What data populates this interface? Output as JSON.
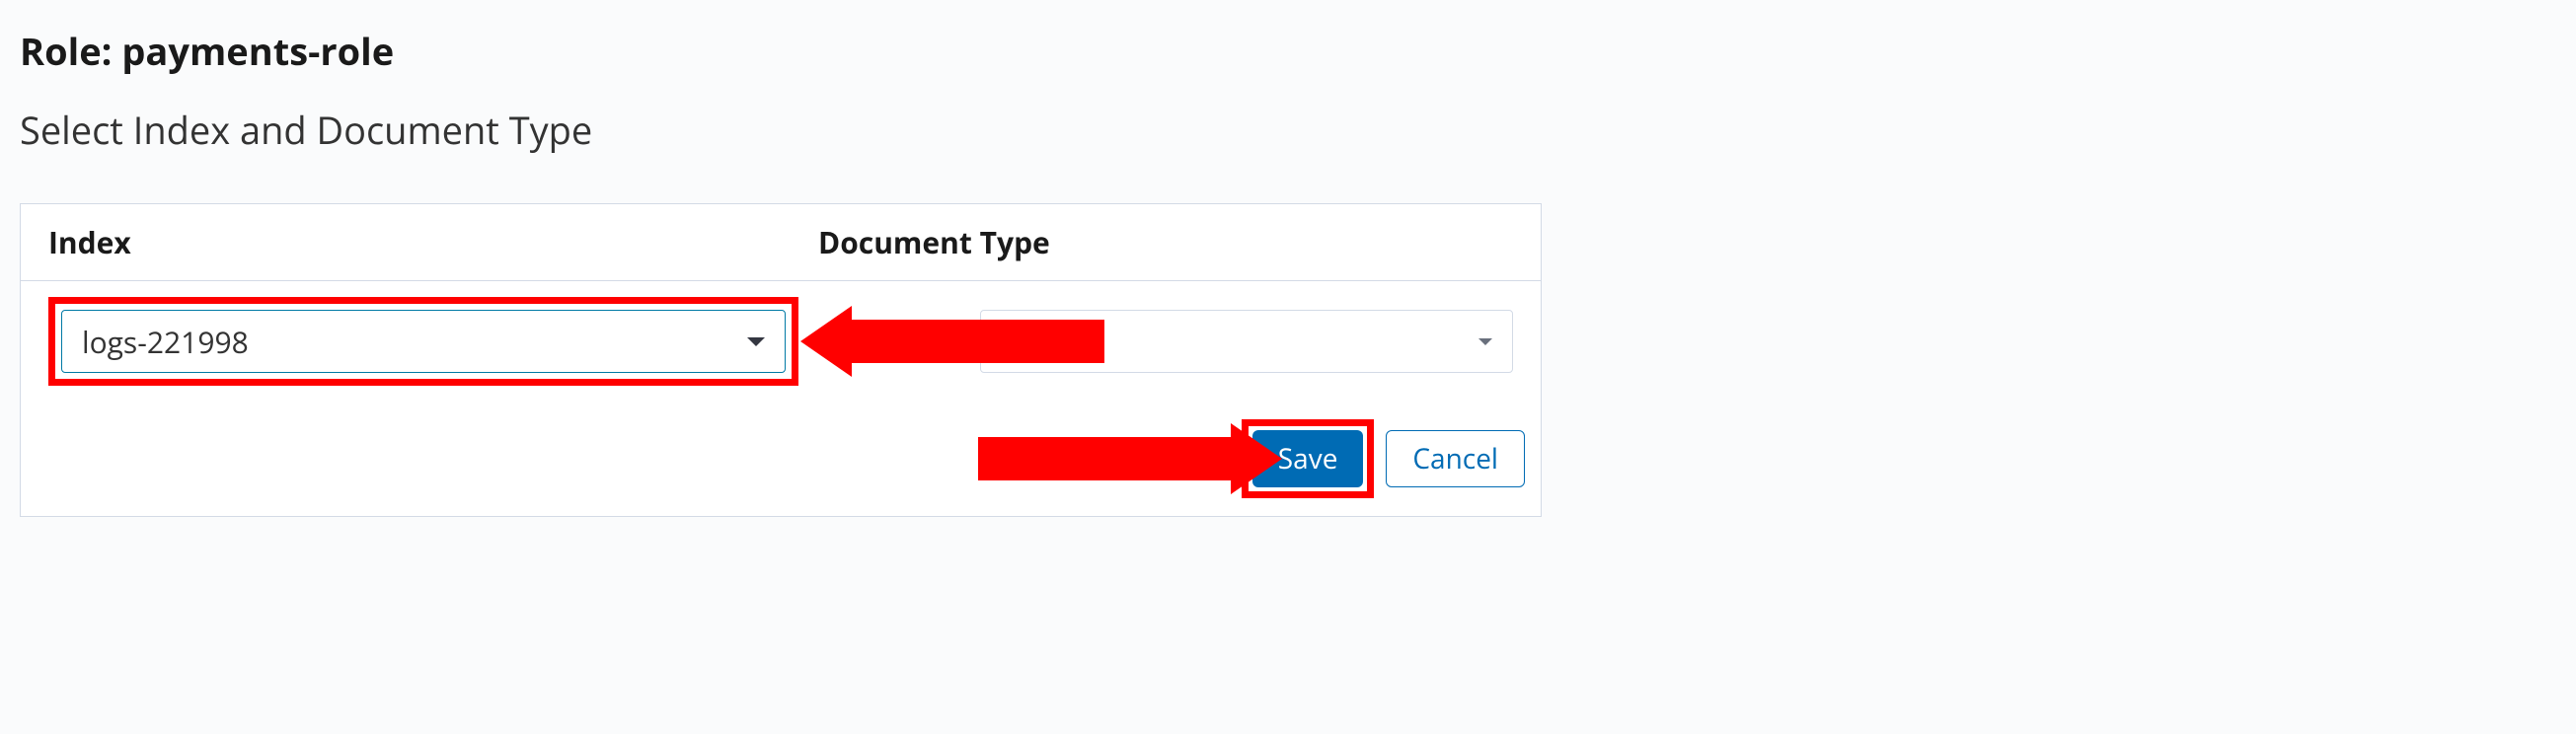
{
  "role_label": "Role: ",
  "role_name": "payments-role",
  "subheading": "Select Index and Document Type",
  "columns": {
    "index": "Index",
    "doctype": "Document Type"
  },
  "index_value": "logs-221998",
  "doctype_value": "",
  "buttons": {
    "save": "Save",
    "cancel": "Cancel"
  }
}
